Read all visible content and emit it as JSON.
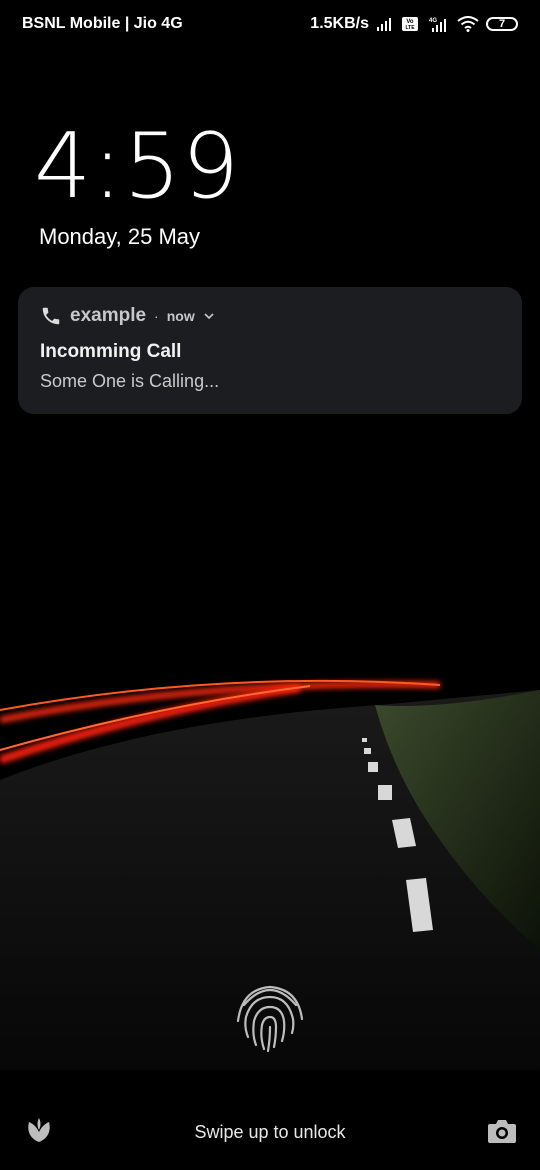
{
  "status_bar": {
    "carrier": "BSNL Mobile | Jio 4G",
    "speed": "1.5KB/s",
    "volte_label": "Vo LTE",
    "network_label": "4G",
    "battery": "7"
  },
  "lockscreen": {
    "time": "4:59",
    "date": "Monday, 25 May"
  },
  "notification": {
    "icon": "phone-icon",
    "app_name": "example",
    "separator": "·",
    "time": "now",
    "title": "Incomming Call",
    "text": "Some One is Calling..."
  },
  "bottom": {
    "swipe_hint": "Swipe up to unlock",
    "left_icon": "leaf-icon",
    "right_icon": "camera-icon"
  },
  "colors": {
    "background": "#000000",
    "notification_bg": "#1b1d20",
    "light_trail": "#ff2a10"
  }
}
